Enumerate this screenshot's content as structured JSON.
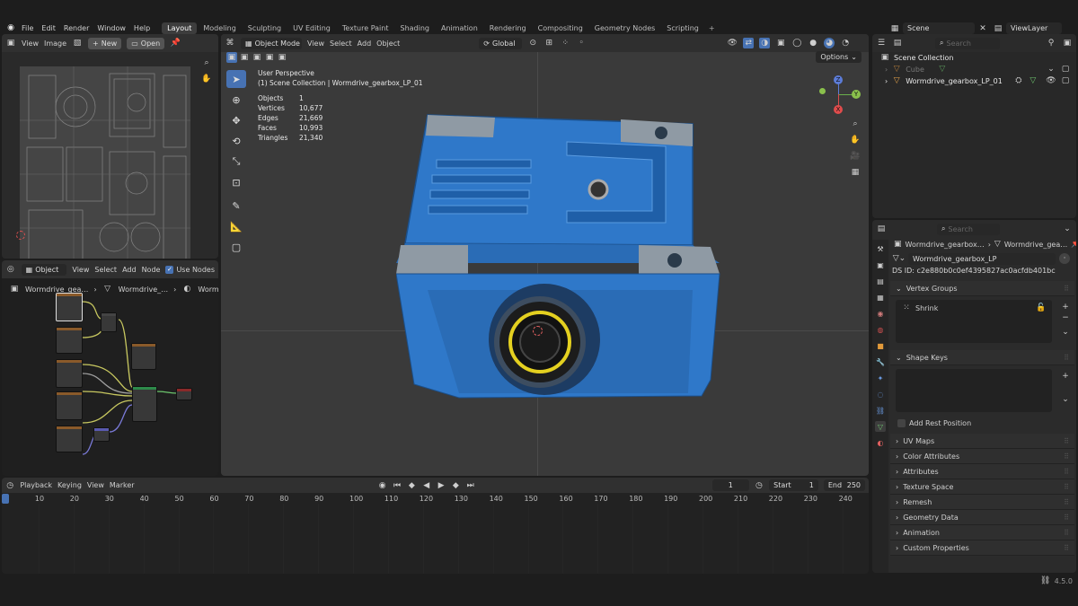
{
  "topbar": {
    "menus": [
      "File",
      "Edit",
      "Render",
      "Window",
      "Help"
    ],
    "workspaces": [
      "Layout",
      "Modeling",
      "Sculpting",
      "UV Editing",
      "Texture Paint",
      "Shading",
      "Animation",
      "Rendering",
      "Compositing",
      "Geometry Nodes",
      "Scripting"
    ],
    "active_workspace": "Layout",
    "add_tab": "+",
    "scene": "Scene",
    "view_layer": "ViewLayer"
  },
  "image_editor": {
    "menus": [
      "View",
      "Image"
    ],
    "new_label": "New",
    "open_label": "Open"
  },
  "node_editor": {
    "mode": "Object",
    "menus": [
      "View",
      "Select",
      "Add",
      "Node"
    ],
    "use_nodes_label": "Use Nodes",
    "breadcrumb": [
      "Wormdrive_gea…",
      "Wormdrive_…",
      "Wormdriv…"
    ]
  },
  "viewport": {
    "mode": "Object Mode",
    "menus": [
      "View",
      "Select",
      "Add",
      "Object"
    ],
    "transform": "Global",
    "options_label": "Options",
    "perspective": "User Perspective",
    "collection_info": "(1) Scene Collection | Wormdrive_gearbox_LP_01",
    "stats": [
      {
        "label": "Objects",
        "value": "1"
      },
      {
        "label": "Vertices",
        "value": "10,677"
      },
      {
        "label": "Edges",
        "value": "21,669"
      },
      {
        "label": "Faces",
        "value": "10,993"
      },
      {
        "label": "Triangles",
        "value": "21,340"
      }
    ],
    "gizmo": {
      "z": "Z",
      "y": "Y",
      "x": "X"
    }
  },
  "timeline": {
    "menus": [
      "Playback",
      "Keying",
      "View",
      "Marker"
    ],
    "current_frame": "1",
    "start_label": "Start",
    "start": "1",
    "end_label": "End",
    "end": "250",
    "ticks": [
      "1",
      "10",
      "20",
      "30",
      "40",
      "50",
      "60",
      "70",
      "80",
      "90",
      "100",
      "110",
      "120",
      "130",
      "140",
      "150",
      "160",
      "170",
      "180",
      "190",
      "200",
      "210",
      "220",
      "230",
      "240"
    ]
  },
  "outliner": {
    "search_placeholder": "Search",
    "root": "Scene Collection",
    "items": [
      {
        "name": "Cube",
        "dim": true
      },
      {
        "name": "Wormdrive_gearbox_LP_01",
        "dim": false
      }
    ]
  },
  "properties": {
    "search_placeholder": "Search",
    "breadcrumb": [
      "Wormdrive_gearbox…",
      "Wormdrive_gea…"
    ],
    "mesh_name": "Wormdrive_gearbox_LP",
    "ds_id": "DS ID: c2e880b0c0ef4395827ac0acfdb401bc",
    "vertex_groups_label": "Vertex Groups",
    "vertex_group_items": [
      "Shrink"
    ],
    "shape_keys_label": "Shape Keys",
    "add_rest_position": "Add Rest Position",
    "collapsed_sections": [
      "UV Maps",
      "Color Attributes",
      "Attributes",
      "Texture Space",
      "Remesh",
      "Geometry Data",
      "Animation",
      "Custom Properties"
    ]
  },
  "statusbar": {
    "version": "4.5.0"
  },
  "colors": {
    "accent": "#4772b3",
    "gearbox_blue": "#2f78c9",
    "header": "#303030",
    "panel": "#2b2b2b",
    "viewport": "#3a3a3a"
  }
}
